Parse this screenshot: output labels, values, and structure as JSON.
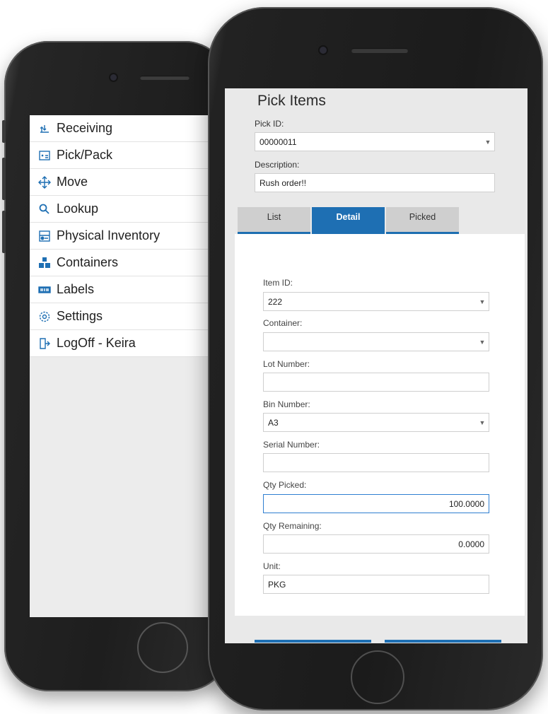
{
  "menu": {
    "items": [
      {
        "label": "Receiving",
        "icon": "receiving-icon"
      },
      {
        "label": "Pick/Pack",
        "icon": "pick-pack-icon"
      },
      {
        "label": "Move",
        "icon": "move-icon"
      },
      {
        "label": "Lookup",
        "icon": "search-icon"
      },
      {
        "label": "Physical Inventory",
        "icon": "inventory-icon"
      },
      {
        "label": "Containers",
        "icon": "containers-icon"
      },
      {
        "label": "Labels",
        "icon": "labels-icon"
      },
      {
        "label": "Settings",
        "icon": "gear-icon"
      },
      {
        "label": "LogOff - Keira",
        "icon": "logoff-icon"
      }
    ]
  },
  "pick": {
    "title": "Pick Items",
    "pick_id_label": "Pick ID:",
    "pick_id_value": "00000011",
    "description_label": "Description:",
    "description_value": "Rush order!!",
    "tabs": [
      "List",
      "Detail",
      "Picked"
    ],
    "active_tab": "Detail"
  },
  "detail": {
    "item_id_label": "Item ID:",
    "item_id_value": "222",
    "container_label": "Container:",
    "container_value": "",
    "lot_label": "Lot Number:",
    "lot_value": "",
    "bin_label": "Bin Number:",
    "bin_value": "A3",
    "serial_label": "Serial Number:",
    "serial_value": "",
    "qty_picked_label": "Qty Picked:",
    "qty_picked_value": "100.0000",
    "qty_remaining_label": "Qty Remaining:",
    "qty_remaining_value": "0.0000",
    "unit_label": "Unit:",
    "unit_value": "PKG"
  },
  "colors": {
    "accent": "#1e6fb3",
    "tab_inactive": "#cfcfcf",
    "screen_bg": "#e9e9e9"
  }
}
